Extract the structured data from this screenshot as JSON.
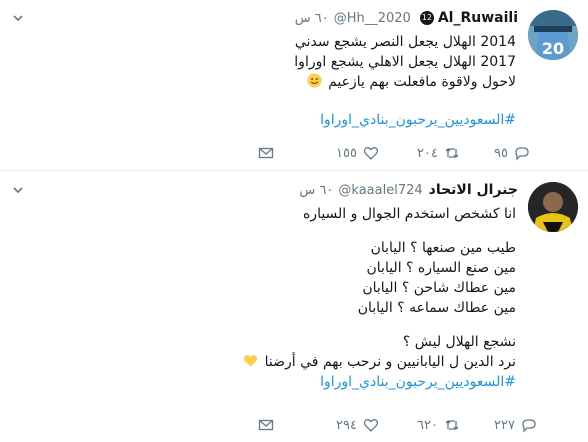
{
  "tweets": [
    {
      "display_name": "Al_Ruwaili",
      "badge": "12",
      "handle": "@Hh__2020",
      "time": "٦٠ س",
      "avatar_label": "20",
      "lines": [
        "2014  الهلال يجعل النصر يشجع سدني",
        "2017 الهلال يجعل الاهلي يشجع اوراوا",
        "لاحول ولاقوة مافعلت بهم يازعيم"
      ],
      "hashtag": "#السعوديين_يرحبون_بنادي_اوراوا",
      "replies": "٩٥",
      "retweets": "٢٠٤",
      "likes": "١٥٥"
    },
    {
      "display_name": "جنرال الاتحاد",
      "handle": "@kaaalel724",
      "time": "٦٠ س",
      "lines": [
        "انا كشخص استخدم الجوال و السياره",
        "",
        "طيب مين صنعها ؟ اليابان",
        "مين صنع السياره ؟ اليابان",
        "مين عطاك شاحن ؟ اليابان",
        "مين عطاك سماعه ؟ اليابان",
        "",
        "نشجع الهلال ليش ؟",
        "نرد الدين ل اليابانيين و نرحب بهم في أرضنا"
      ],
      "hashtag": "#السعوديين_يرحبون_بنادي_اوراوا",
      "replies": "٢٢٧",
      "retweets": "٦٢٠",
      "likes": "٢٩٤"
    }
  ],
  "icons": {
    "caret": "chevron-down-icon",
    "reply": "reply-icon",
    "retweet": "retweet-icon",
    "like": "heart-icon",
    "message": "mail-icon"
  },
  "colors": {
    "hashtag": "#1b95e0",
    "secondary_text": "#657786",
    "emoji_smile": "#ffcc4d",
    "emoji_heart": "#ffcc4d"
  }
}
